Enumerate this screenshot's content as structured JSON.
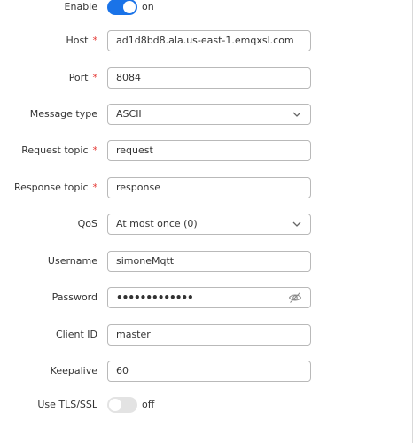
{
  "colors": {
    "accent": "#1a73e8",
    "required": "#e53935",
    "toggle_off": "#e3e3e3"
  },
  "enable": {
    "label": "Enable",
    "state": "on",
    "value": true
  },
  "host": {
    "label": "Host",
    "required_mark": "*",
    "value": "ad1d8bd8.ala.us-east-1.emqxsl.com"
  },
  "port": {
    "label": "Port",
    "required_mark": "*",
    "value": "8084"
  },
  "message_type": {
    "label": "Message type",
    "value": "ASCII",
    "icon": "chevron-down-icon"
  },
  "request_topic": {
    "label": "Request topic",
    "required_mark": "*",
    "value": "request"
  },
  "response_topic": {
    "label": "Response topic",
    "required_mark": "*",
    "value": "response"
  },
  "qos": {
    "label": "QoS",
    "value": "At most once (0)",
    "icon": "chevron-down-icon"
  },
  "username": {
    "label": "Username",
    "value": "simoneMqtt"
  },
  "password": {
    "label": "Password",
    "value": "•••••••••••••",
    "icon": "eye-slash-icon"
  },
  "client_id": {
    "label": "Client ID",
    "value": "master"
  },
  "keepalive": {
    "label": "Keepalive",
    "value": "60"
  },
  "tls": {
    "label": "Use TLS/SSL",
    "state": "off",
    "value": false
  }
}
